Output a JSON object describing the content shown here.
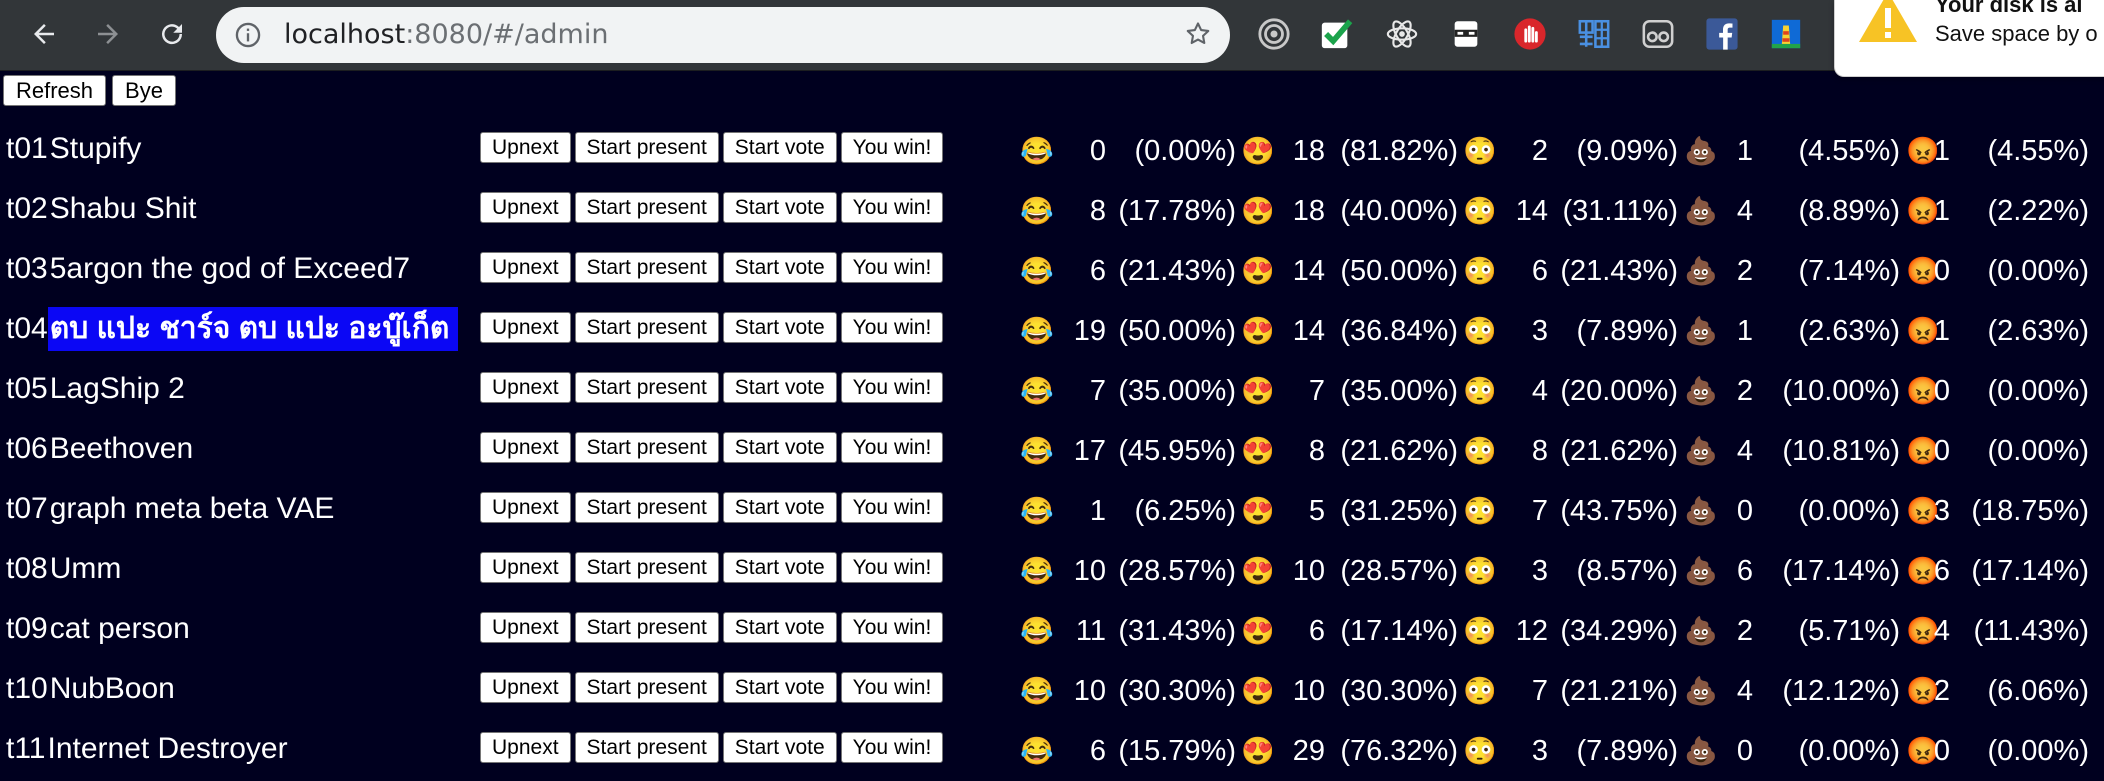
{
  "browser": {
    "host": "localhost",
    "path": ":8080/#/admin",
    "toast_title": "Your disk is al",
    "toast_body": "Save space by o"
  },
  "toolbar": {
    "refresh_label": "Refresh",
    "bye_label": "Bye"
  },
  "controls": {
    "upnext": "Upnext",
    "present": "Start present",
    "vote": "Start vote",
    "win": "You win!"
  },
  "emoji": {
    "laugh": "😂",
    "love": "😍",
    "wow": "😳",
    "poop": "💩",
    "angry": "😡"
  },
  "teams": [
    {
      "id": "t01",
      "name": "Stupify",
      "highlight": false,
      "stats": [
        {
          "c": "0",
          "p": "(0.00%)"
        },
        {
          "c": "18",
          "p": "(81.82%)"
        },
        {
          "c": "2",
          "p": "(9.09%)"
        },
        {
          "c": "1",
          "p": "(4.55%)"
        },
        {
          "c": "1",
          "p": "(4.55%)"
        }
      ]
    },
    {
      "id": "t02",
      "name": "Shabu Shit",
      "highlight": false,
      "stats": [
        {
          "c": "8",
          "p": "(17.78%)"
        },
        {
          "c": "18",
          "p": "(40.00%)"
        },
        {
          "c": "14",
          "p": "(31.11%)"
        },
        {
          "c": "4",
          "p": "(8.89%)"
        },
        {
          "c": "1",
          "p": "(2.22%)"
        }
      ]
    },
    {
      "id": "t03",
      "name": "5argon the god of Exceed7",
      "highlight": false,
      "stats": [
        {
          "c": "6",
          "p": "(21.43%)"
        },
        {
          "c": "14",
          "p": "(50.00%)"
        },
        {
          "c": "6",
          "p": "(21.43%)"
        },
        {
          "c": "2",
          "p": "(7.14%)"
        },
        {
          "c": "0",
          "p": "(0.00%)"
        }
      ]
    },
    {
      "id": "t04",
      "name": "ตบ แปะ ชาร์จ ตบ แปะ อะบู๊เก็ต",
      "highlight": true,
      "stats": [
        {
          "c": "19",
          "p": "(50.00%)"
        },
        {
          "c": "14",
          "p": "(36.84%)"
        },
        {
          "c": "3",
          "p": "(7.89%)"
        },
        {
          "c": "1",
          "p": "(2.63%)"
        },
        {
          "c": "1",
          "p": "(2.63%)"
        }
      ]
    },
    {
      "id": "t05",
      "name": "LagShip 2",
      "highlight": false,
      "stats": [
        {
          "c": "7",
          "p": "(35.00%)"
        },
        {
          "c": "7",
          "p": "(35.00%)"
        },
        {
          "c": "4",
          "p": "(20.00%)"
        },
        {
          "c": "2",
          "p": "(10.00%)"
        },
        {
          "c": "0",
          "p": "(0.00%)"
        }
      ]
    },
    {
      "id": "t06",
      "name": "Beethoven",
      "highlight": false,
      "stats": [
        {
          "c": "17",
          "p": "(45.95%)"
        },
        {
          "c": "8",
          "p": "(21.62%)"
        },
        {
          "c": "8",
          "p": "(21.62%)"
        },
        {
          "c": "4",
          "p": "(10.81%)"
        },
        {
          "c": "0",
          "p": "(0.00%)"
        }
      ]
    },
    {
      "id": "t07",
      "name": "graph meta beta VAE",
      "highlight": false,
      "stats": [
        {
          "c": "1",
          "p": "(6.25%)"
        },
        {
          "c": "5",
          "p": "(31.25%)"
        },
        {
          "c": "7",
          "p": "(43.75%)"
        },
        {
          "c": "0",
          "p": "(0.00%)"
        },
        {
          "c": "3",
          "p": "(18.75%)"
        }
      ]
    },
    {
      "id": "t08",
      "name": "Umm",
      "highlight": false,
      "stats": [
        {
          "c": "10",
          "p": "(28.57%)"
        },
        {
          "c": "10",
          "p": "(28.57%)"
        },
        {
          "c": "3",
          "p": "(8.57%)"
        },
        {
          "c": "6",
          "p": "(17.14%)"
        },
        {
          "c": "6",
          "p": "(17.14%)"
        }
      ]
    },
    {
      "id": "t09",
      "name": "cat person",
      "highlight": false,
      "stats": [
        {
          "c": "11",
          "p": "(31.43%)"
        },
        {
          "c": "6",
          "p": "(17.14%)"
        },
        {
          "c": "12",
          "p": "(34.29%)"
        },
        {
          "c": "2",
          "p": "(5.71%)"
        },
        {
          "c": "4",
          "p": "(11.43%)"
        }
      ]
    },
    {
      "id": "t10",
      "name": "NubBoon",
      "highlight": false,
      "stats": [
        {
          "c": "10",
          "p": "(30.30%)"
        },
        {
          "c": "10",
          "p": "(30.30%)"
        },
        {
          "c": "7",
          "p": "(21.21%)"
        },
        {
          "c": "4",
          "p": "(12.12%)"
        },
        {
          "c": "2",
          "p": "(6.06%)"
        }
      ]
    },
    {
      "id": "t11",
      "name": "Internet Destroyer",
      "highlight": false,
      "stats": [
        {
          "c": "6",
          "p": "(15.79%)"
        },
        {
          "c": "29",
          "p": "(76.32%)"
        },
        {
          "c": "3",
          "p": "(7.89%)"
        },
        {
          "c": "0",
          "p": "(0.00%)"
        },
        {
          "c": "0",
          "p": "(0.00%)"
        }
      ]
    }
  ]
}
